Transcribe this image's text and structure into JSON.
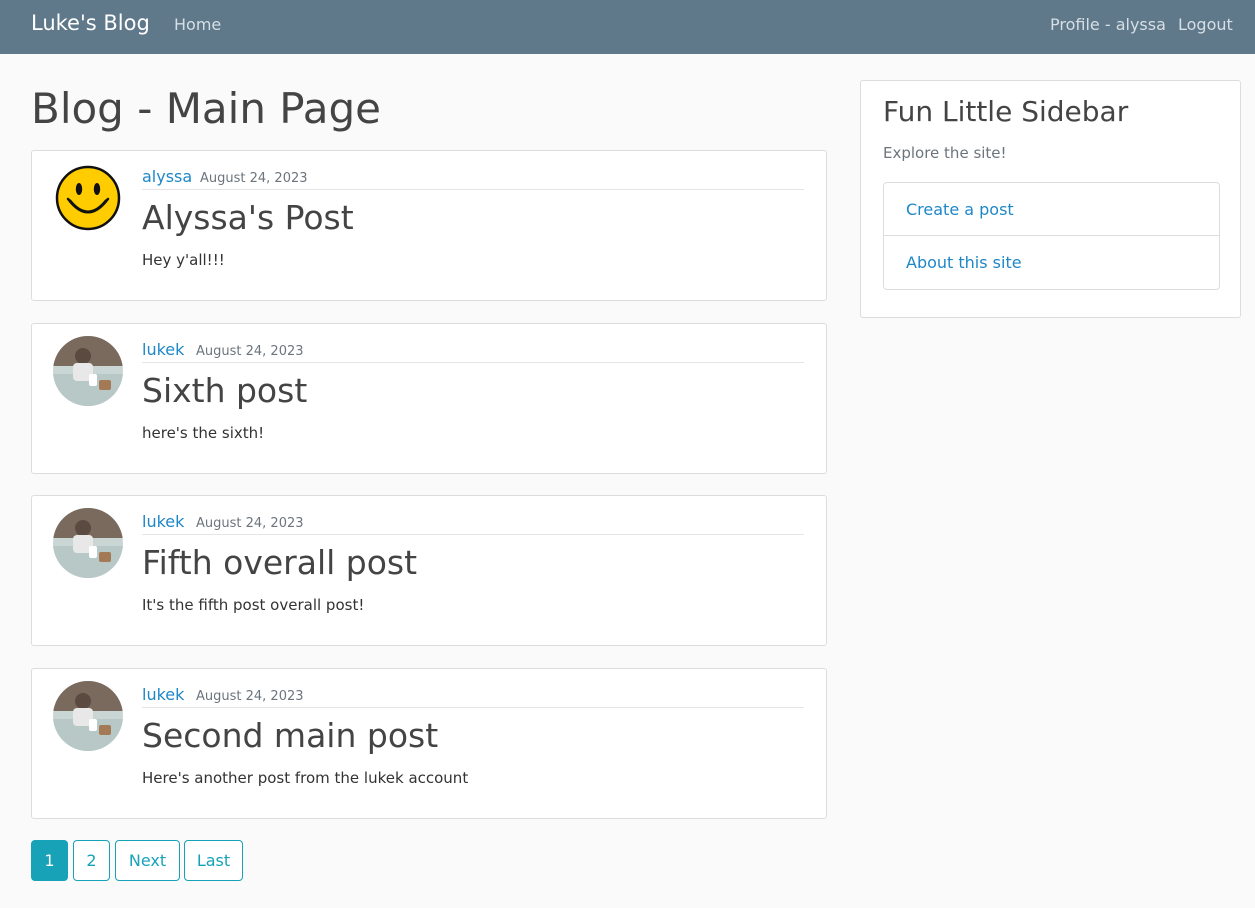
{
  "navbar": {
    "brand": "Luke's Blog",
    "home": "Home",
    "profile": "Profile - alyssa",
    "logout": "Logout"
  },
  "page_title": "Blog - Main Page",
  "posts": [
    {
      "author": "alyssa",
      "date": "August 24, 2023",
      "title": "Alyssa's Post",
      "body": "Hey y'all!!!",
      "avatar": "smiley-avatar"
    },
    {
      "author": "lukek",
      "date": "August 24, 2023",
      "title": "Sixth post",
      "body": "here's the sixth!",
      "avatar": "photo-avatar"
    },
    {
      "author": "lukek",
      "date": "August 24, 2023",
      "title": "Fifth overall post",
      "body": "It's the fifth post overall post!",
      "avatar": "photo-avatar"
    },
    {
      "author": "lukek",
      "date": "August 24, 2023",
      "title": "Second main post",
      "body": "Here's another post from the lukek account",
      "avatar": "photo-avatar"
    }
  ],
  "sidebar": {
    "title": "Fun Little Sidebar",
    "subtitle": "Explore the site!",
    "items": [
      {
        "label": "Create a post"
      },
      {
        "label": "About this site"
      }
    ]
  },
  "pagination": {
    "pages": [
      "1",
      "2"
    ],
    "current": "1",
    "next": "Next",
    "last": "Last"
  },
  "colors": {
    "navbar": "#5f788a",
    "link": "#1e87c8",
    "pagination": "#17a2b8"
  }
}
